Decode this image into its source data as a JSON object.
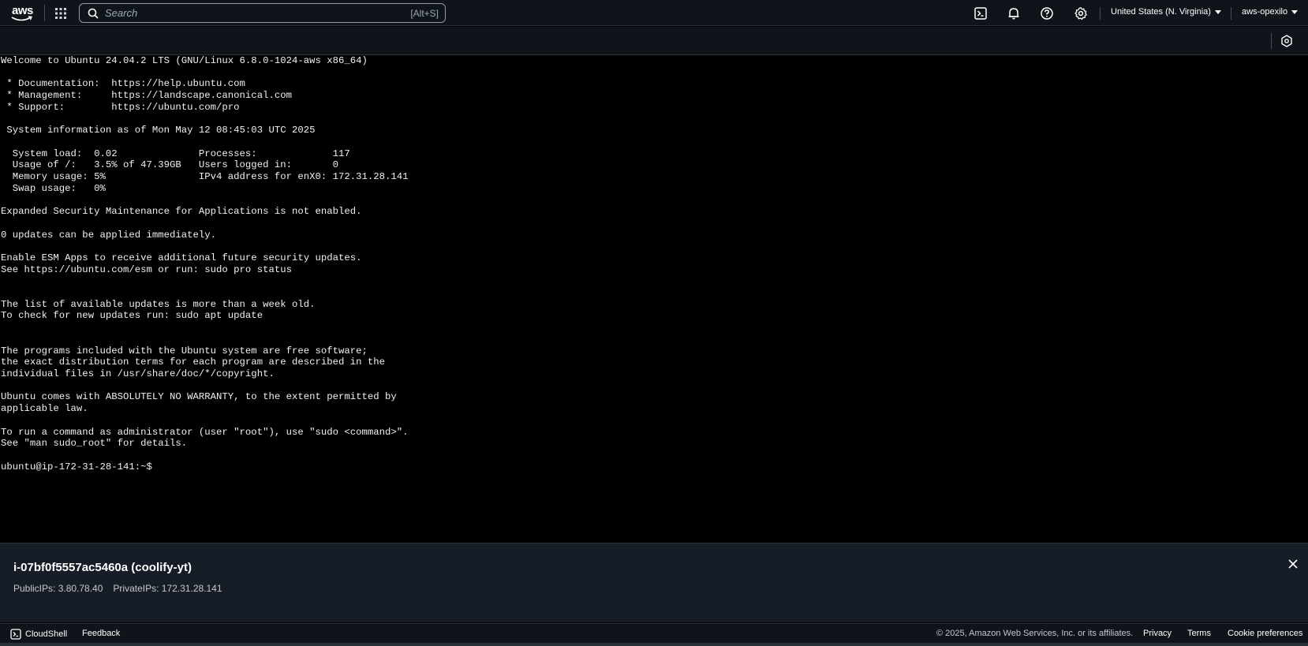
{
  "topnav": {
    "logo_text": "aws",
    "search": {
      "placeholder": "Search",
      "shortcut": "[Alt+S]"
    },
    "icons": [
      "cloudshell-icon",
      "bell-icon",
      "help-icon",
      "gear-icon"
    ],
    "region": "United States (N. Virginia)",
    "account": "aws-opexilo"
  },
  "terminal": {
    "lines": [
      "Welcome to Ubuntu 24.04.2 LTS (GNU/Linux 6.8.0-1024-aws x86_64)",
      "",
      " * Documentation:  https://help.ubuntu.com",
      " * Management:     https://landscape.canonical.com",
      " * Support:        https://ubuntu.com/pro",
      "",
      " System information as of Mon May 12 08:45:03 UTC 2025",
      "",
      "  System load:  0.02              Processes:             117",
      "  Usage of /:   3.5% of 47.39GB   Users logged in:       0",
      "  Memory usage: 5%                IPv4 address for enX0: 172.31.28.141",
      "  Swap usage:   0%",
      "",
      "Expanded Security Maintenance for Applications is not enabled.",
      "",
      "0 updates can be applied immediately.",
      "",
      "Enable ESM Apps to receive additional future security updates.",
      "See https://ubuntu.com/esm or run: sudo pro status",
      "",
      "",
      "The list of available updates is more than a week old.",
      "To check for new updates run: sudo apt update",
      "",
      "",
      "The programs included with the Ubuntu system are free software;",
      "the exact distribution terms for each program are described in the",
      "individual files in /usr/share/doc/*/copyright.",
      "",
      "Ubuntu comes with ABSOLUTELY NO WARRANTY, to the extent permitted by",
      "applicable law.",
      "",
      "To run a command as administrator (user \"root\"), use \"sudo <command>\".",
      "See \"man sudo_root\" for details.",
      ""
    ],
    "prompt": "ubuntu@ip-172-31-28-141:~$ "
  },
  "instance": {
    "title": "i-07bf0f5557ac5460a (coolify-yt)",
    "public_ips": "PublicIPs: 3.80.78.40",
    "private_ips": "PrivateIPs: 172.31.28.141"
  },
  "footer": {
    "cloudshell": "CloudShell",
    "feedback": "Feedback",
    "copyright": "© 2025, Amazon Web Services, Inc. or its affiliates.",
    "privacy": "Privacy",
    "terms": "Terms",
    "cookie_preferences": "Cookie preferences"
  },
  "colors": {
    "nav_bg": "#0f141a",
    "panel_bg": "#161d26",
    "terminal_bg": "#000000",
    "terminal_fg": "#f0f0f0"
  }
}
